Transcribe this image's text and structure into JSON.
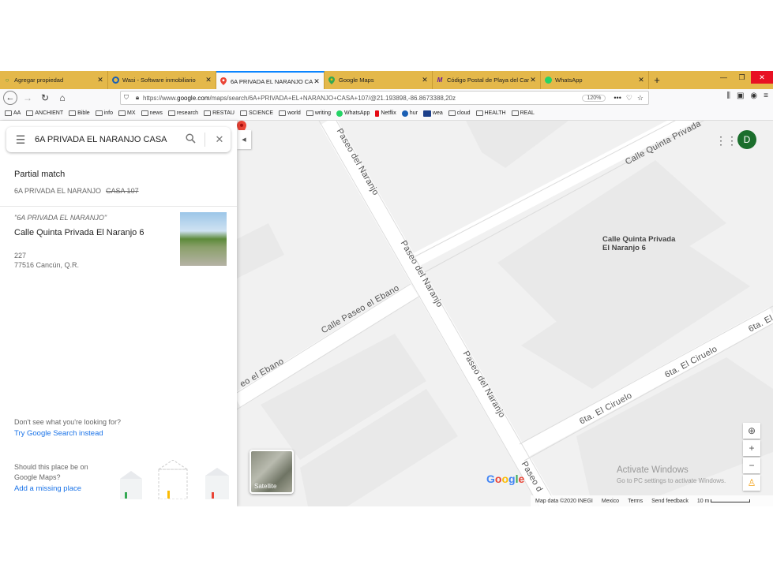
{
  "browser": {
    "tabs": [
      {
        "label": "Agregar propiedad",
        "icon": "circle-icon",
        "active": false
      },
      {
        "label": "Wasi - Software inmobiliario",
        "icon": "wasi-icon",
        "active": false
      },
      {
        "label": "6A PRIVADA EL NARANJO CASA",
        "icon": "maps-pin-icon",
        "active": true
      },
      {
        "label": "Google Maps",
        "icon": "maps-pin-icon",
        "active": false
      },
      {
        "label": "Código Postal de Playa del Car",
        "icon": "m-icon",
        "active": false
      },
      {
        "label": "WhatsApp",
        "icon": "whatsapp-icon",
        "active": false
      }
    ],
    "new_tab": "+",
    "url_prefix": "https://www.",
    "url_domain": "google.com",
    "url_rest": "/maps/search/6A+PRIVADA+EL+NARANJO+CASA+107/@21.193898,-86.8673388,20z",
    "zoom": "120%",
    "url_more": "•••"
  },
  "bookmarks": [
    {
      "label": "AA",
      "type": "folder"
    },
    {
      "label": "ANCHIENT",
      "type": "folder"
    },
    {
      "label": "Bible",
      "type": "folder"
    },
    {
      "label": "info",
      "type": "folder"
    },
    {
      "label": "MX",
      "type": "folder"
    },
    {
      "label": "news",
      "type": "folder"
    },
    {
      "label": "research",
      "type": "folder"
    },
    {
      "label": "RESTAU",
      "type": "folder"
    },
    {
      "label": "SCIENCE",
      "type": "folder"
    },
    {
      "label": "world",
      "type": "folder"
    },
    {
      "label": "writing",
      "type": "folder"
    },
    {
      "label": "WhatsApp",
      "type": "whatsapp"
    },
    {
      "label": "Netflix",
      "type": "netflix"
    },
    {
      "label": "hur",
      "type": "noaa"
    },
    {
      "label": "wea",
      "type": "wea"
    },
    {
      "label": "cloud",
      "type": "folder"
    },
    {
      "label": "HEALTH",
      "type": "folder"
    },
    {
      "label": "REAL",
      "type": "folder"
    }
  ],
  "sidebar": {
    "search_query": "6A PRIVADA EL NARANJO CASA",
    "partial_match_title": "Partial match",
    "partial_match_text": "6A PRIVADA EL NARANJO",
    "partial_match_strike": "CASA 107",
    "result_quote": "\"6A PRIVADA EL NARANJO\"",
    "result_name": "Calle Quinta Privada El Naranjo 6",
    "result_number": "227",
    "result_city": "77516 Cancún, Q.R.",
    "not_seeing": "Don't see what you're looking for?",
    "try_search": "Try Google Search instead",
    "should_place_1": "Should this place be on",
    "should_place_2": "Google Maps?",
    "add_missing": "Add a missing place"
  },
  "map": {
    "streets": {
      "quinta_privada": "Calle Quinta Privada",
      "paseo_naranjo_top": "Paseo del Naranjo",
      "paseo_naranjo_mid": "Paseo del Naranjo",
      "paseo_naranjo_low": "Paseo del Naranjo",
      "paseo_bottom": "Paseo d",
      "paseo_ebano": "Calle Paseo el Ebano",
      "ebano_left": "eo el Ebano",
      "ciruelo_1": "6ta. El Ciruelo",
      "ciruelo_2": "6ta. El Ciruelo",
      "ciruelo_right": "6ta. El"
    },
    "pin_label_1": "Calle Quinta Privada",
    "pin_label_2": "El Naranjo 6",
    "avatar_letter": "D",
    "satellite_label": "Satellite",
    "activate_title": "Activate Windows",
    "activate_sub": "Go to PC settings to activate Windows.",
    "footer": {
      "map_data": "Map data ©2020 INEGI",
      "country": "Mexico",
      "terms": "Terms",
      "feedback": "Send feedback",
      "scale": "10 m"
    },
    "logo_letters": [
      "G",
      "o",
      "o",
      "g",
      "l",
      "e"
    ],
    "colors": {
      "pin": "#ea4335",
      "link": "#1a73e8",
      "tab_strip": "#e4b84a"
    }
  }
}
